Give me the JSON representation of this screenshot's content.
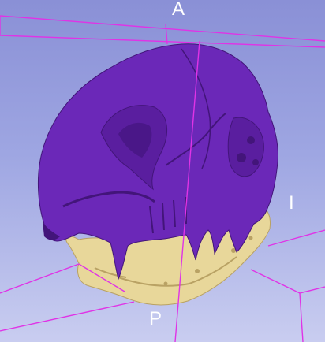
{
  "viewer": {
    "orientation": {
      "top": "A",
      "right": "I",
      "bottom": "P"
    },
    "colors": {
      "background_top": "#8a90d6",
      "background_bottom": "#c9cdf0",
      "bounding_box": "#e033e6",
      "cranium": "#6b28b8",
      "cranium_shadow": "#43157a",
      "mandible": "#e8d79a",
      "mandible_shadow": "#b9a264"
    },
    "models": [
      "cranium",
      "mandible"
    ]
  }
}
